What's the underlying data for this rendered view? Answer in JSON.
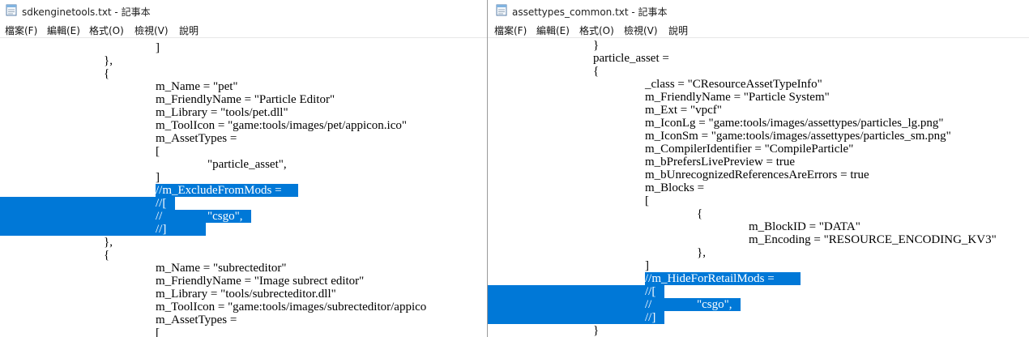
{
  "left": {
    "title": "sdkenginetools.txt - 記事本",
    "menu": [
      "檔案(F)",
      "編輯(E)",
      "格式(O)",
      "檢視(V)",
      "說明"
    ],
    "lines": [
      {
        "indent": 3,
        "text": "]"
      },
      {
        "indent": 2,
        "text": "},"
      },
      {
        "indent": 2,
        "text": "{"
      },
      {
        "indent": 3,
        "text": "m_Name = \"pet\""
      },
      {
        "indent": 3,
        "text": "m_FriendlyName = \"Particle Editor\""
      },
      {
        "indent": 3,
        "text": "m_Library = \"tools/pet.dll\""
      },
      {
        "indent": 3,
        "text": "m_ToolIcon = \"game:tools/images/pet/appicon.ico\""
      },
      {
        "indent": 3,
        "text": "m_AssetTypes ="
      },
      {
        "indent": 3,
        "text": "["
      },
      {
        "indent": 4,
        "text": "\"particle_asset\","
      },
      {
        "indent": 3,
        "text": "]"
      },
      {
        "indent": 3,
        "text": "//m_ExcludeFromMods = ",
        "selected": true,
        "selStart": 3
      },
      {
        "indent": 3,
        "text": "//[",
        "selected": true
      },
      {
        "indent": 3,
        "text": "//\t\"csgo\",",
        "selected": true
      },
      {
        "indent": 3,
        "text": "//]",
        "selected": true
      },
      {
        "indent": 2,
        "text": "},"
      },
      {
        "indent": 2,
        "text": "{"
      },
      {
        "indent": 3,
        "text": "m_Name = \"subrecteditor\""
      },
      {
        "indent": 3,
        "text": "m_FriendlyName = \"Image subrect editor\""
      },
      {
        "indent": 3,
        "text": "m_Library = \"tools/subrecteditor.dll\""
      },
      {
        "indent": 3,
        "text": "m_ToolIcon = \"game:tools/images/subrecteditor/appico"
      },
      {
        "indent": 3,
        "text": "m_AssetTypes ="
      },
      {
        "indent": 3,
        "text": "["
      }
    ]
  },
  "right": {
    "title": "assettypes_common.txt - 記事本",
    "menu": [
      "檔案(F)",
      "編輯(E)",
      "格式(O)",
      "檢視(V)",
      "說明"
    ],
    "lines": [
      {
        "indent": 2,
        "text": "}"
      },
      {
        "indent": 2,
        "text": "particle_asset ="
      },
      {
        "indent": 2,
        "text": "{"
      },
      {
        "indent": 3,
        "text": "_class = \"CResourceAssetTypeInfo\""
      },
      {
        "indent": 3,
        "text": "m_FriendlyName = \"Particle System\""
      },
      {
        "indent": 3,
        "text": "m_Ext = \"vpcf\""
      },
      {
        "indent": 3,
        "text": "m_IconLg = \"game:tools/images/assettypes/particles_lg.png\""
      },
      {
        "indent": 3,
        "text": "m_IconSm = \"game:tools/images/assettypes/particles_sm.png\""
      },
      {
        "indent": 3,
        "text": "m_CompilerIdentifier = \"CompileParticle\""
      },
      {
        "indent": 3,
        "text": "m_bPrefersLivePreview = true"
      },
      {
        "indent": 3,
        "text": "m_bUnrecognizedReferencesAreErrors = true"
      },
      {
        "indent": 3,
        "text": "m_Blocks ="
      },
      {
        "indent": 3,
        "text": "["
      },
      {
        "indent": 4,
        "text": "{"
      },
      {
        "indent": 5,
        "text": "m_BlockID = \"DATA\""
      },
      {
        "indent": 5,
        "text": "m_Encoding = \"RESOURCE_ENCODING_KV3\""
      },
      {
        "indent": 4,
        "text": "},"
      },
      {
        "indent": 3,
        "text": "]"
      },
      {
        "indent": 3,
        "text": "//m_HideForRetailMods = ",
        "selected": true,
        "selStart": 3
      },
      {
        "indent": 3,
        "text": "//[",
        "selected": true
      },
      {
        "indent": 3,
        "text": "//\t\"csgo\",",
        "selected": true
      },
      {
        "indent": 3,
        "text": "//]",
        "selected": true
      },
      {
        "indent": 2,
        "text": "}"
      }
    ]
  }
}
